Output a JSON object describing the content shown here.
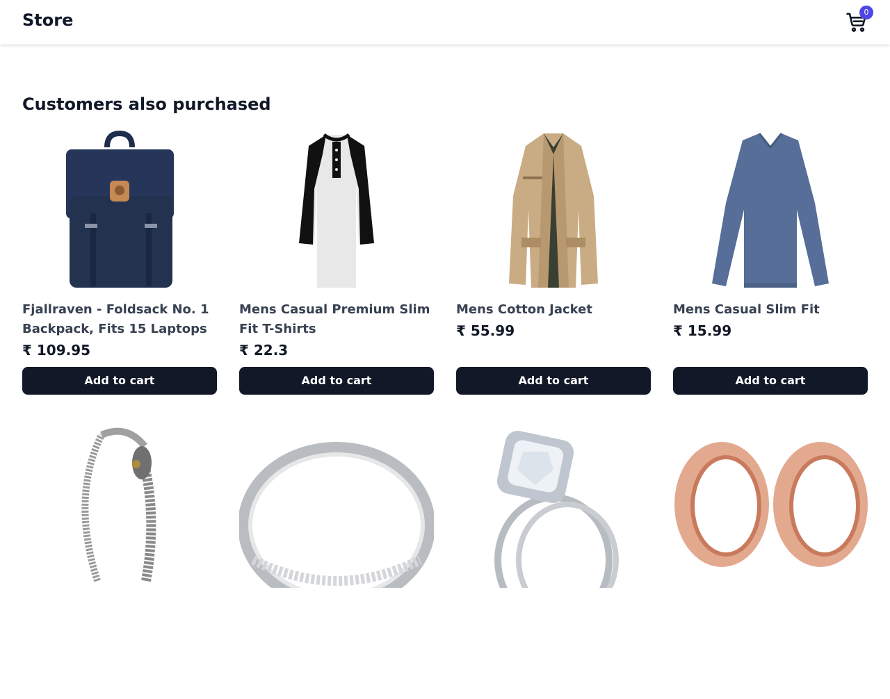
{
  "header": {
    "logo": "Store",
    "cart_icon": "shopping-cart-icon",
    "cart_count": "0"
  },
  "section": {
    "title": "Customers also purchased"
  },
  "currency": "₹",
  "products": [
    {
      "title": "Fjallraven - Foldsack No. 1 Backpack, Fits 15 Laptops",
      "price": "₹ 109.95",
      "button": "Add to cart",
      "image": "navy-backpack"
    },
    {
      "title": "Mens Casual Premium Slim Fit T-Shirts",
      "price": "₹ 22.3",
      "button": "Add to cart",
      "image": "raglan-henley-shirt"
    },
    {
      "title": "Mens Cotton Jacket",
      "price": "₹ 55.99",
      "button": "Add to cart",
      "image": "beige-cotton-jacket"
    },
    {
      "title": "Mens Casual Slim Fit",
      "price": "₹ 15.99",
      "button": "Add to cart",
      "image": "blue-long-sleeve-shirt"
    },
    {
      "title": "",
      "price": "",
      "button": "",
      "image": "silver-dragon-bracelet"
    },
    {
      "title": "",
      "price": "",
      "button": "",
      "image": "silver-ring"
    },
    {
      "title": "",
      "price": "",
      "button": "",
      "image": "diamond-ring-set"
    },
    {
      "title": "",
      "price": "",
      "button": "",
      "image": "rose-gold-tunnel-plugs"
    }
  ],
  "colors": {
    "accent": "#4f46e5",
    "button_bg": "#111827",
    "title_text": "#374151"
  }
}
